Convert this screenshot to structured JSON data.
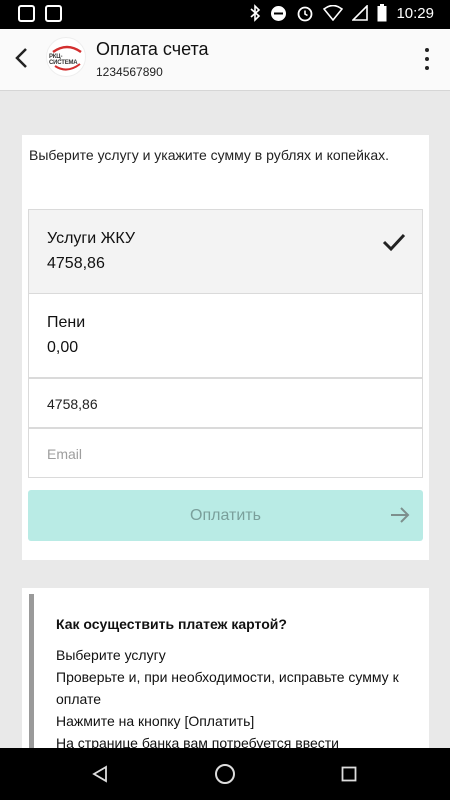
{
  "status_bar": {
    "time": "10:29"
  },
  "app_bar": {
    "title": "Оплата счета",
    "subtitle": "1234567890",
    "logo_text": "РКЦ-СИСТЕМА"
  },
  "form": {
    "instruction": "Выберите услугу и укажите сумму в рублях и копейках.",
    "services": [
      {
        "name": "Услуги ЖКУ",
        "amount": "4758,86",
        "selected": true
      },
      {
        "name": "Пени",
        "amount": "0,00",
        "selected": false
      }
    ],
    "amount_value": "4758,86",
    "email_placeholder": "Email",
    "pay_button": "Оплатить"
  },
  "how_to": {
    "title": "Как осуществить платеж картой?",
    "lines": [
      "Выберите услугу",
      "Проверьте и, при необходимости, исправьте сумму к оплате",
      "Нажмите на кнопку [Оплатить]",
      "На странице банка вам потребуется ввести"
    ]
  },
  "colors": {
    "pay_button_bg": "#b9ebe5",
    "pay_button_text": "#7a9f9b",
    "accent_bar": "#9a9a9a"
  }
}
